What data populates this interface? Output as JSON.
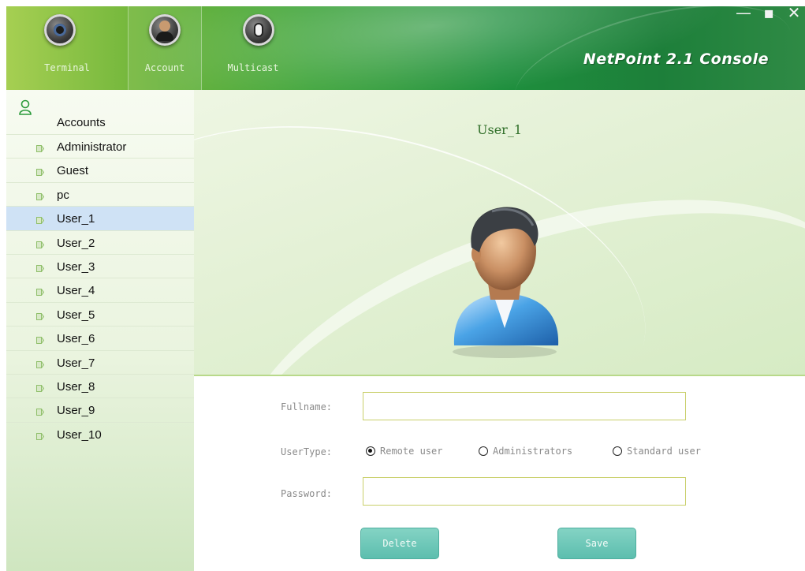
{
  "window": {
    "product_title": "NetPoint 2.1 Console",
    "controls": {
      "minimize": "—",
      "maximize": "▪",
      "close": "✕"
    }
  },
  "toolbar": {
    "tabs": [
      {
        "label": "Terminal",
        "icon": "webcam-icon"
      },
      {
        "label": "Account",
        "icon": "user-account-icon",
        "selected": true
      },
      {
        "label": "Multicast",
        "icon": "speaker-icon"
      }
    ]
  },
  "sidebar": {
    "header": "Accounts",
    "items": [
      {
        "label": "Administrator"
      },
      {
        "label": "Guest"
      },
      {
        "label": "pc"
      },
      {
        "label": "User_1",
        "selected": true
      },
      {
        "label": "User_2"
      },
      {
        "label": "User_3"
      },
      {
        "label": "User_4"
      },
      {
        "label": "User_5"
      },
      {
        "label": "User_6"
      },
      {
        "label": "User_7"
      },
      {
        "label": "User_8"
      },
      {
        "label": "User_9"
      },
      {
        "label": "User_10"
      }
    ]
  },
  "profile": {
    "name": "User_1"
  },
  "form": {
    "fullname_label": "Fullname:",
    "fullname_value": "",
    "usertype_label": "UserType:",
    "usertype_options": [
      {
        "label": "Remote user",
        "checked": true
      },
      {
        "label": "Administrators",
        "checked": false
      },
      {
        "label": "Standard user",
        "checked": false
      }
    ],
    "password_label": "Password:",
    "password_value": "",
    "delete_label": "Delete",
    "save_label": "Save"
  },
  "colors": {
    "toolbar_green": "#3ea43a",
    "selected_row": "#cfe2f5",
    "button_teal": "#5cbeae",
    "field_border": "#c9cf6a",
    "profile_name": "#2f6e28"
  }
}
